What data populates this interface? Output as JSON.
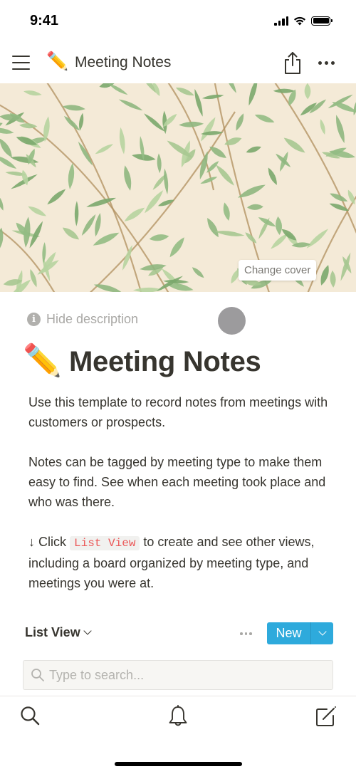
{
  "status_bar": {
    "time": "9:41",
    "icons": [
      "cellular-signal-icon",
      "wifi-icon",
      "battery-icon"
    ]
  },
  "nav_bar": {
    "menu_icon": "hamburger-menu-icon",
    "page_emoji": "✏️",
    "title": "Meeting Notes",
    "share_icon": "share-icon",
    "more_icon": "more-horizontal-icon"
  },
  "cover": {
    "description": "Green willow leaf wallpaper pattern on cream background",
    "change_cover_label": "Change cover"
  },
  "page": {
    "hide_description_label": "Hide description",
    "emoji": "✏️",
    "title": "Meeting Notes",
    "description": {
      "paragraph1": "Use this template to record notes from meetings with customers or prospects.",
      "paragraph2": "Notes can be tagged by meeting type to make them easy to find. See when each meeting took place and who was there.",
      "paragraph3_prefix": "↓ Click ",
      "paragraph3_code": "List View",
      "paragraph3_suffix": " to create and see other views, including a board organized by meeting type, and meetings you were at."
    }
  },
  "database": {
    "view_name": "List View",
    "new_button_label": "New",
    "search_placeholder": "Type to search...",
    "search_value": ""
  },
  "tab_bar": {
    "items": [
      {
        "name": "search",
        "icon": "search-icon"
      },
      {
        "name": "notifications",
        "icon": "bell-icon"
      },
      {
        "name": "new-page",
        "icon": "compose-icon"
      }
    ]
  },
  "colors": {
    "accent": "#2eaadc",
    "text": "#37352f",
    "muted_text": "#a9a8a5",
    "code_text": "#eb5757",
    "code_bg": "#f1f1ef",
    "cover_bg": "#f4ead7",
    "leaf_green": "#8fb77f",
    "branch_brown": "#b08f5e"
  }
}
